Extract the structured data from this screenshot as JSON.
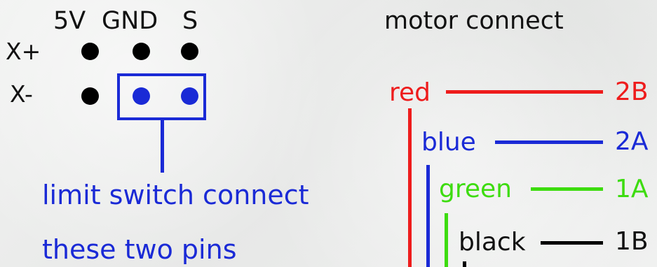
{
  "colors": {
    "black": "#000000",
    "blue": "#1a2ad6",
    "red": "#ee1c1c",
    "green": "#3ddc0f"
  },
  "header": {
    "pin_5v": "5V",
    "pin_gnd": "GND",
    "pin_s": "S"
  },
  "rows": {
    "x_plus": "X+",
    "x_minus": "X-"
  },
  "note": {
    "line1": "limit switch connect",
    "line2": "these two pins"
  },
  "motor": {
    "title": "motor connect",
    "wires": [
      {
        "color": "red",
        "pin": "2B"
      },
      {
        "color": "blue",
        "pin": "2A"
      },
      {
        "color": "green",
        "pin": "1A"
      },
      {
        "color": "black",
        "pin": "1B"
      }
    ]
  }
}
